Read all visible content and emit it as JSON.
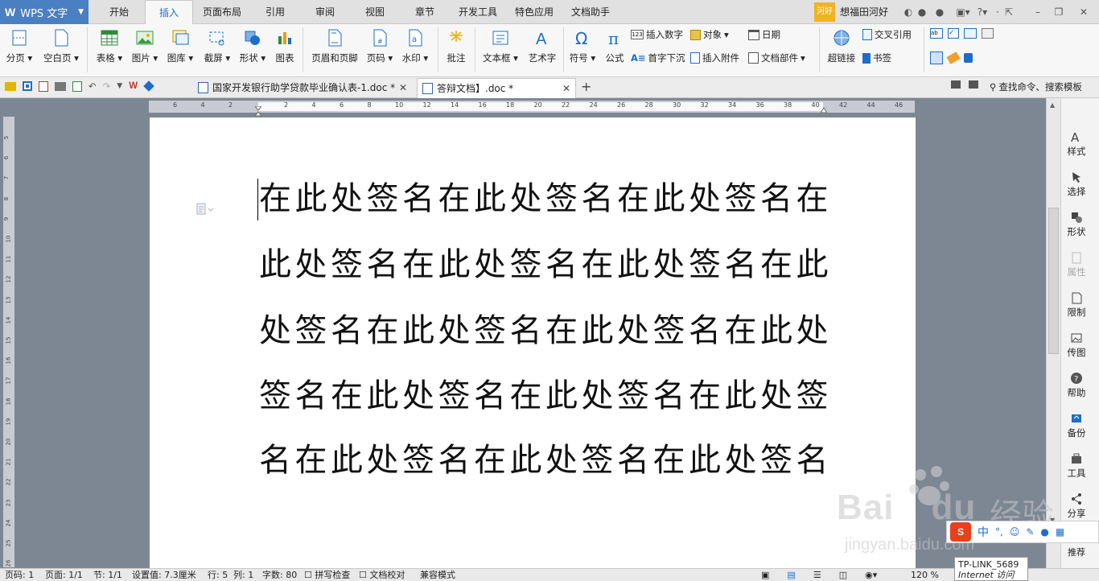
{
  "app": {
    "logo": "W",
    "name": "WPS 文字"
  },
  "menu_tabs": [
    "开始",
    "插入",
    "页面布局",
    "引用",
    "审阅",
    "视图",
    "章节",
    "开发工具",
    "特色应用",
    "文档助手"
  ],
  "active_tab": "插入",
  "user": {
    "badge": "河好",
    "name": "想福田河好"
  },
  "ribbon": {
    "split_page": "分页",
    "blank_page": "空白页",
    "table": "表格",
    "picture": "图片",
    "gallery": "图库",
    "screenshot": "截屏",
    "shape": "形状",
    "chart": "图表",
    "header_footer": "页眉和页脚",
    "page_number": "页码",
    "watermark": "水印",
    "comment": "批注",
    "textbox": "文本框",
    "wordart": "艺术字",
    "symbol": "符号",
    "formula": "公式",
    "insert_number": "插入数字",
    "object": "对象",
    "date": "日期",
    "drop_cap": "首字下沉",
    "attachment": "插入附件",
    "doc_parts": "文档部件",
    "hyperlink": "超链接",
    "cross_ref": "交叉引用",
    "bookmark": "书签"
  },
  "doc_tabs": [
    {
      "title": "国家开发银行助学贷款毕业确认表-1.doc *",
      "active": false
    },
    {
      "title": "答辩文档】.doc *",
      "active": true
    }
  ],
  "search_placeholder": "查找命令、搜索模板",
  "ruler_numbers": [
    "6",
    "4",
    "2",
    "",
    "2",
    "4",
    "6",
    "8",
    "10",
    "12",
    "14",
    "16",
    "18",
    "20",
    "22",
    "24",
    "26",
    "28",
    "30",
    "32",
    "34",
    "36",
    "38",
    "40",
    "42",
    "44",
    "46"
  ],
  "vruler_numbers": [
    "5",
    "6",
    "7",
    "8",
    "9",
    "10",
    "11",
    "12",
    "13",
    "14",
    "15",
    "16",
    "17",
    "18",
    "19",
    "20",
    "21",
    "22",
    "23",
    "24",
    "25",
    "26",
    "27"
  ],
  "document_lines": [
    "在此处签名在此处签名在此处签名在",
    "此处签名在此处签名在此处签名在此",
    "处签名在此处签名在此处签名在此处",
    "签名在此处签名在此处签名在此处签",
    "名在此处签名在此处签名在此处签名"
  ],
  "side_panel": [
    "样式",
    "选择",
    "形状",
    "属性",
    "限制",
    "传图",
    "帮助",
    "备份",
    "工具",
    "分享",
    "推荐"
  ],
  "status": {
    "page_code": "页码: 1",
    "pages": "页面: 1/1",
    "section": "节: 1/1",
    "setting": "设置值: 7.3厘米",
    "row": "行: 5",
    "col": "列: 1",
    "word_count": "字数: 80",
    "spellcheck": "拼写检查",
    "doc_check": "文档校对",
    "compat": "兼容模式",
    "zoom": "120 %"
  },
  "ime": {
    "label": "中"
  },
  "tooltip": {
    "line1": "TP-LINK_5689",
    "line2": "Internet 访问"
  },
  "watermark": {
    "brand": "Bai",
    "brand2": "du",
    "cn": "经验",
    "url": "jingyan.baidu.com"
  },
  "colors": {
    "accent": "#1e6ec8",
    "app_blue": "#4a7fc1",
    "badge": "#f0b323",
    "ime_red": "#e8401c"
  }
}
